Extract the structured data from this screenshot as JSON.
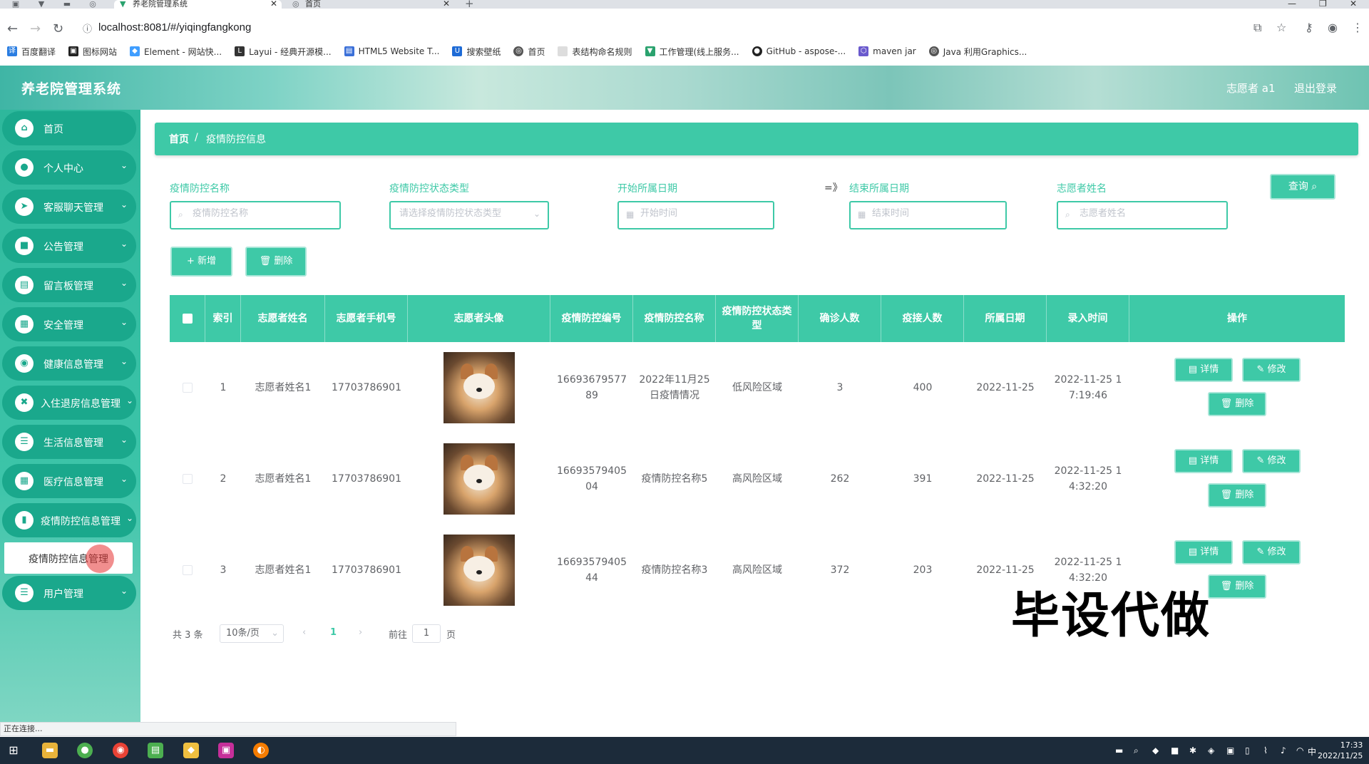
{
  "browser": {
    "tabs": [
      {
        "label": "养老院管理系统",
        "active": true
      },
      {
        "label": "首页",
        "active": false
      }
    ],
    "url": "localhost:8081/#/yiqingfangkong",
    "bookmarks": [
      "百度翻译",
      "图标网站",
      "Element - 网站快...",
      "Layui - 经典开源模...",
      "HTML5 Website T...",
      "搜索壁纸",
      "首页",
      "表结构命名规则",
      "工作管理(线上服务...",
      "GitHub - aspose-...",
      "maven jar",
      "Java 利用Graphics..."
    ]
  },
  "header": {
    "title": "养老院管理系统",
    "user": "志愿者 a1",
    "logout": "退出登录"
  },
  "sidebar": {
    "items": [
      {
        "label": "首页",
        "icon": "home-icon",
        "glyph": "⌂",
        "has_arrow": false
      },
      {
        "label": "个人中心",
        "icon": "user-icon",
        "glyph": "●",
        "has_arrow": true
      },
      {
        "label": "客服聊天管理",
        "icon": "send-icon",
        "glyph": "➤",
        "has_arrow": true
      },
      {
        "label": "公告管理",
        "icon": "bag-icon",
        "glyph": "■",
        "has_arrow": true
      },
      {
        "label": "留言板管理",
        "icon": "board-icon",
        "glyph": "▤",
        "has_arrow": true
      },
      {
        "label": "安全管理",
        "icon": "grid-icon",
        "glyph": "▦",
        "has_arrow": true
      },
      {
        "label": "健康信息管理",
        "icon": "pin-icon",
        "glyph": "◉",
        "has_arrow": true
      },
      {
        "label": "入住退房信息管理",
        "icon": "cross-icon",
        "glyph": "✖",
        "has_arrow": true
      },
      {
        "label": "生活信息管理",
        "icon": "list-icon",
        "glyph": "☰",
        "has_arrow": true
      },
      {
        "label": "医疗信息管理",
        "icon": "grid-icon",
        "glyph": "▦",
        "has_arrow": true
      },
      {
        "label": "疫情防控信息管理",
        "icon": "chart-icon",
        "glyph": "▮",
        "has_arrow": true
      },
      {
        "label": "用户管理",
        "icon": "menu-icon",
        "glyph": "☰",
        "has_arrow": true
      }
    ],
    "submenu_label": "疫情防控信息管理"
  },
  "breadcrumb": {
    "home": "首页",
    "sep": "/",
    "current": "疫情防控信息"
  },
  "filters": {
    "name_label": "疫情防控名称",
    "name_placeholder": "疫情防控名称",
    "type_label": "疫情防控状态类型",
    "type_placeholder": "请选择疫情防控状态类型",
    "start_label": "开始所属日期",
    "start_placeholder": "开始时间",
    "range_sep": "=》",
    "end_label": "结束所属日期",
    "end_placeholder": "结束时间",
    "vol_label": "志愿者姓名",
    "vol_placeholder": "志愿者姓名",
    "query": "查询"
  },
  "actions": {
    "add": "+ 新增",
    "delete": "删除"
  },
  "table": {
    "columns": [
      "索引",
      "志愿者姓名",
      "志愿者手机号",
      "志愿者头像",
      "疫情防控编号",
      "疫情防控名称",
      "疫情防控状态类型",
      "确诊人数",
      "疫接人数",
      "所属日期",
      "录入时间",
      "操作"
    ],
    "rows": [
      {
        "idx": "1",
        "name": "志愿者姓名1",
        "phone": "17703786901",
        "code": "1669367957789",
        "title": "2022年11月25日疫情情况",
        "status": "低风险区域",
        "confirmed": "3",
        "contacts": "400",
        "date": "2022-11-25",
        "time": "2022-11-25 17:19:46"
      },
      {
        "idx": "2",
        "name": "志愿者姓名1",
        "phone": "17703786901",
        "code": "1669357940504",
        "title": "疫情防控名称5",
        "status": "高风险区域",
        "confirmed": "262",
        "contacts": "391",
        "date": "2022-11-25",
        "time": "2022-11-25 14:32:20"
      },
      {
        "idx": "3",
        "name": "志愿者姓名1",
        "phone": "17703786901",
        "code": "1669357940544",
        "title": "疫情防控名称3",
        "status": "高风险区域",
        "confirmed": "372",
        "contacts": "203",
        "date": "2022-11-25",
        "time": "2022-11-25 14:32:20"
      }
    ],
    "op_detail": "详情",
    "op_edit": "修改",
    "op_delete": "删除"
  },
  "pagination": {
    "total": "共 3 条",
    "size": "10条/页",
    "current": "1",
    "goto": "前往",
    "goto_value": "1",
    "page_unit": "页"
  },
  "watermark": "毕设代做",
  "status_text": "正在连接...",
  "clock": {
    "time": "17:33",
    "date": "2022/11/25"
  },
  "colors": {
    "accent": "#3ec9a7",
    "sidebar_item": "#1aa88c"
  }
}
